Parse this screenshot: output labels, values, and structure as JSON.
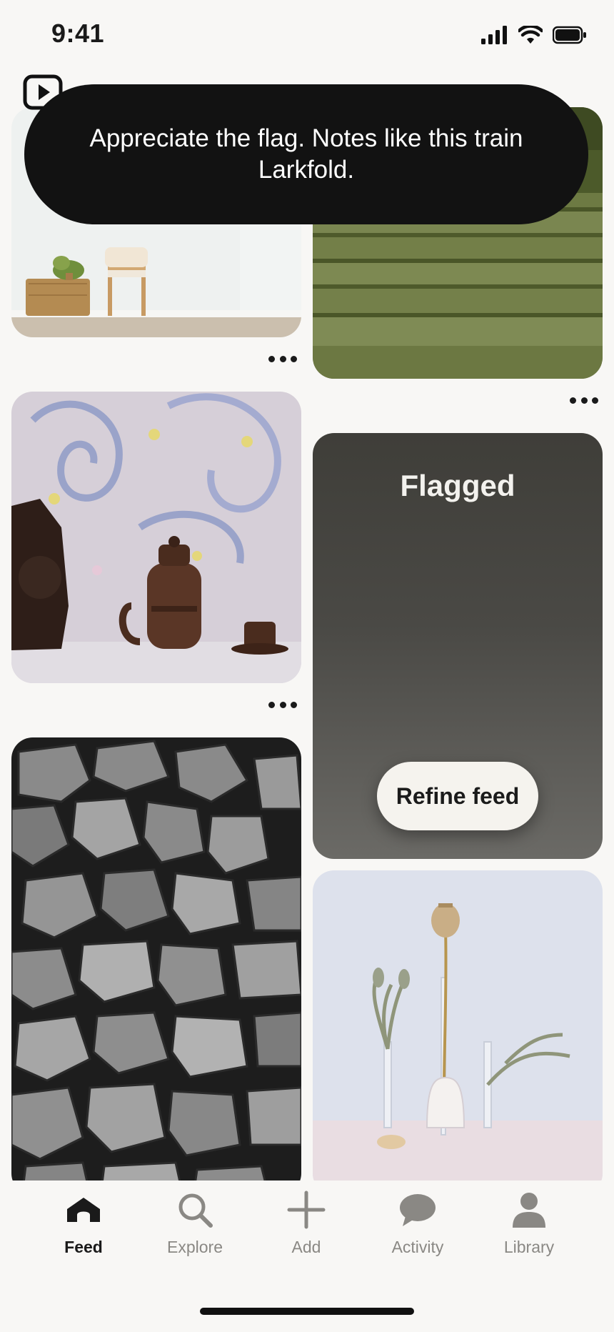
{
  "status_bar": {
    "time": "9:41",
    "icons": [
      "cellular-signal-icon",
      "wifi-icon",
      "battery-icon"
    ]
  },
  "toast": {
    "message": "Appreciate the flag. Notes like this train Larkfold."
  },
  "feed": {
    "pins": [
      {
        "id": "room-chair",
        "image": "minimal room with plant, wicker cabinet and wooden chair"
      },
      {
        "id": "folded-fabric",
        "image": "stacked folded olive green fabric"
      },
      {
        "id": "ceramics",
        "image": "dark clay pottery on paisley cloth"
      },
      {
        "id": "flagged"
      },
      {
        "id": "stone-wall",
        "image": "black and white stone wall"
      },
      {
        "id": "dried-flowers",
        "image": "dried flowers in glass vases"
      }
    ],
    "flagged_card": {
      "title": "Flagged",
      "action_label": "Refine feed"
    }
  },
  "tab_bar": {
    "tabs": [
      {
        "label": "Feed",
        "icon": "home-icon",
        "active": true
      },
      {
        "label": "Explore",
        "icon": "search-icon",
        "active": false
      },
      {
        "label": "Add",
        "icon": "plus-icon",
        "active": false
      },
      {
        "label": "Activity",
        "icon": "chat-bubble-icon",
        "active": false
      },
      {
        "label": "Library",
        "icon": "profile-icon",
        "active": false
      }
    ]
  }
}
